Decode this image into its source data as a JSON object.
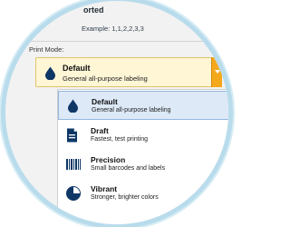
{
  "collate": {
    "title": "orted",
    "example": "Example: 1,1,2,2,3,3"
  },
  "print_mode": {
    "label": "Print Mode:",
    "selected": {
      "title": "Default",
      "subtitle": "General all-purpose labeling",
      "icon": "drop-icon"
    },
    "options": [
      {
        "title": "Default",
        "subtitle": "General all-purpose labeling",
        "icon": "drop-icon",
        "selected": true
      },
      {
        "title": "Draft",
        "subtitle": "Fastest, test printing",
        "icon": "document-icon",
        "selected": false
      },
      {
        "title": "Precision",
        "subtitle": "Small barcodes and labels",
        "icon": "barcode-icon",
        "selected": false
      },
      {
        "title": "Vibrant",
        "subtitle": "Stronger, brighter colors",
        "icon": "contrast-icon",
        "selected": false
      }
    ]
  },
  "colors": {
    "accent": "#f4a81c",
    "icon": "#0e3766",
    "selected_bg": "#dde9f7",
    "field_bg": "#fff6d6",
    "badge_ring": "#b9dcec"
  }
}
